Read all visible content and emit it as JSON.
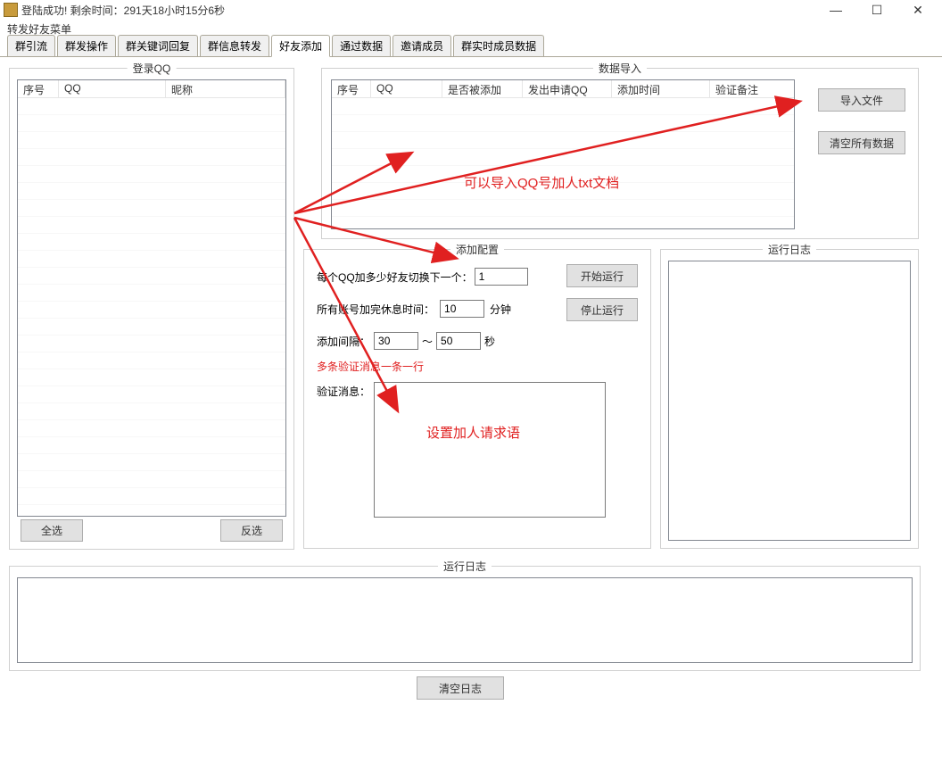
{
  "title": "登陆成功! 剩余时间：291天18小时15分6秒",
  "menu": {
    "main": "转发好友菜单"
  },
  "tabs": [
    "群引流",
    "群发操作",
    "群关键词回复",
    "群信息转发",
    "好友添加",
    "通过数据",
    "邀请成员",
    "群实时成员数据"
  ],
  "activeTab": 4,
  "loginQQ": {
    "title": "登录QQ",
    "cols": [
      "序号",
      "QQ",
      "昵称"
    ],
    "selectAll": "全选",
    "invertSel": "反选"
  },
  "dataImport": {
    "title": "数据导入",
    "cols": [
      "序号",
      "QQ",
      "是否被添加",
      "发出申请QQ",
      "添加时间",
      "验证备注"
    ],
    "importBtn": "导入文件",
    "clearBtn": "清空所有数据"
  },
  "addConfig": {
    "title": "添加配置",
    "switchLabel": "每个QQ加多少好友切换下一个：",
    "switchVal": "1",
    "restLabel": "所有账号加完休息时间：",
    "restVal": "10",
    "restUnit": "分钟",
    "intervalLabel": "添加间隔：",
    "intervalFrom": "30",
    "intervalTo": "50",
    "intervalSep": "～",
    "intervalUnit": "秒",
    "verifyHint": "多条验证消息一条一行",
    "verifyLabel": "验证消息：",
    "startBtn": "开始运行",
    "stopBtn": "停止运行"
  },
  "runLog": {
    "title": "运行日志"
  },
  "bottomLog": {
    "title": "运行日志",
    "clearBtn": "清空日志"
  },
  "annotations": {
    "a1": "可以导入QQ号加人txt文档",
    "a2": "设置加人请求语"
  },
  "winBtns": {
    "min": "—",
    "max": "☐",
    "close": "✕"
  }
}
